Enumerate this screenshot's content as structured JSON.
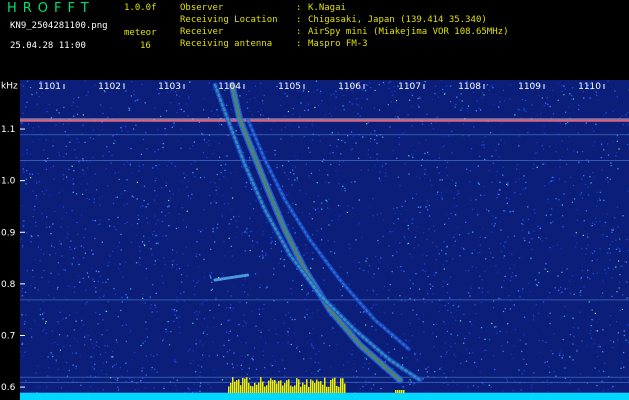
{
  "header": {
    "app_title": "HROFFT",
    "version": "1.0.0f",
    "file_name": "KN9_2504281100.png",
    "meteor_label": "meteor",
    "meteor_count": "16",
    "datetime": "25.04.28 11:00",
    "info": [
      {
        "key": "Observer",
        "value": "K.Nagai"
      },
      {
        "key": "Receiving Location",
        "value": "Chigasaki, Japan (139.414 35.340)"
      },
      {
        "key": "Receiver",
        "value": "AirSpy mini (Miakejima VOR 108.65MHz)"
      },
      {
        "key": "Receiving antenna",
        "value": "Maspro FM-3"
      }
    ]
  },
  "colors": {
    "text_yellow": "#e0e000",
    "title_green": "#00e070",
    "background": "#000000",
    "noise_base": "#0a1e7a",
    "trail_red": "#ff3020",
    "trail_yellow": "#ffe040",
    "power_bar": "#00d8ff"
  },
  "chart_data": {
    "type": "heatmap",
    "y_axis_label": "kHz",
    "x_ticks": [
      "1101",
      "1102",
      "1103",
      "1104",
      "1105",
      "1106",
      "1107",
      "1108",
      "1109",
      "1110"
    ],
    "y_ticks": [
      "1.1",
      "1.0",
      "0.9",
      "0.8",
      "0.7",
      "0.6"
    ],
    "y_tick_values": [
      1.1,
      1.0,
      0.9,
      0.8,
      0.7,
      0.6
    ],
    "ylim": [
      0.575,
      1.195
    ],
    "x_minutes": [
      1101,
      1110
    ],
    "carrier_khz": 1.117
  }
}
